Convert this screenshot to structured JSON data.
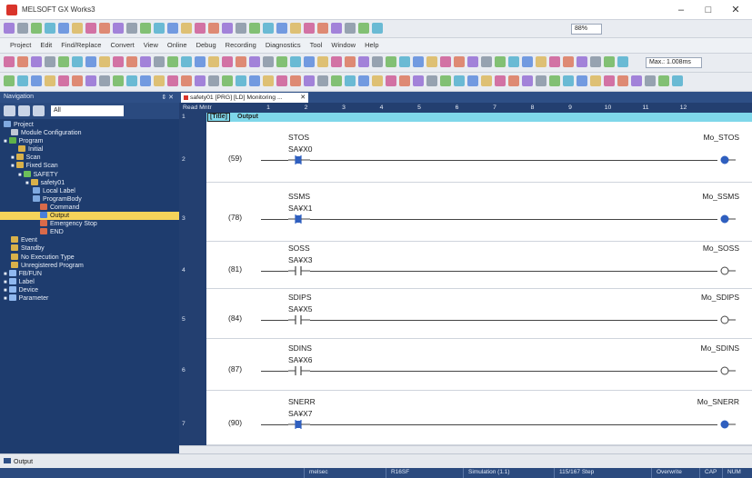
{
  "window": {
    "title": "MELSOFT GX Works3",
    "buttons": {
      "minimize": "–",
      "maximize": "□",
      "close": "✕"
    }
  },
  "menu": {
    "items": [
      "Project",
      "Edit",
      "Find/Replace",
      "Convert",
      "View",
      "Online",
      "Debug",
      "Recording",
      "Diagnostics",
      "Tool",
      "Window",
      "Help"
    ]
  },
  "toolbar": {
    "zoom": "88%",
    "max_scan": "Max.: 1.008ms"
  },
  "navigation": {
    "title": "Navigation",
    "pin": "⇕ ✕",
    "filter_value": "All",
    "tree": [
      {
        "label": "Project",
        "indent": 0,
        "icon": "#7fa9e0",
        "prefix": ""
      },
      {
        "label": "Module Configuration",
        "indent": 1,
        "icon": "#c0c8d6",
        "prefix": ""
      },
      {
        "label": "Program",
        "indent": 0,
        "icon": "#5fb24a",
        "prefix": "■"
      },
      {
        "label": "Initial",
        "indent": 2,
        "icon": "#d9b14a",
        "prefix": ""
      },
      {
        "label": "Scan",
        "indent": 1,
        "icon": "#d9b14a",
        "prefix": "■"
      },
      {
        "label": "Fixed Scan",
        "indent": 1,
        "icon": "#d9b14a",
        "prefix": "■"
      },
      {
        "label": "SAFETY",
        "indent": 2,
        "icon": "#6cc05a",
        "prefix": "■"
      },
      {
        "label": "safety01",
        "indent": 3,
        "icon": "#d9b14a",
        "prefix": "■"
      },
      {
        "label": "Local Label",
        "indent": 4,
        "icon": "#7fa9e0",
        "prefix": ""
      },
      {
        "label": "ProgramBody",
        "indent": 4,
        "icon": "#7fa9e0",
        "prefix": ""
      },
      {
        "label": "Command",
        "indent": 5,
        "icon": "#d96a4a",
        "prefix": ""
      },
      {
        "label": "Output",
        "indent": 5,
        "icon": "#4a7fd9",
        "prefix": "",
        "selected": true
      },
      {
        "label": "Emergency Stop",
        "indent": 5,
        "icon": "#d96a4a",
        "prefix": ""
      },
      {
        "label": "END",
        "indent": 5,
        "icon": "#d96a4a",
        "prefix": ""
      },
      {
        "label": "Event",
        "indent": 1,
        "icon": "#d9b14a",
        "prefix": ""
      },
      {
        "label": "Standby",
        "indent": 1,
        "icon": "#d9b14a",
        "prefix": ""
      },
      {
        "label": "No Execution Type",
        "indent": 1,
        "icon": "#d9b14a",
        "prefix": ""
      },
      {
        "label": "Unregistered Program",
        "indent": 1,
        "icon": "#d9b14a",
        "prefix": ""
      },
      {
        "label": "FB/FUN",
        "indent": 0,
        "icon": "#8fb8ef",
        "prefix": "■"
      },
      {
        "label": "Label",
        "indent": 0,
        "icon": "#8fb8ef",
        "prefix": "■"
      },
      {
        "label": "Device",
        "indent": 0,
        "icon": "#8fb8ef",
        "prefix": "■"
      },
      {
        "label": "Parameter",
        "indent": 0,
        "icon": "#8fb8ef",
        "prefix": "■"
      }
    ]
  },
  "editor": {
    "tab_label": "safety01 [PRG] [LD] Monitoring ...",
    "tab_close": "✕",
    "read_mode_label": "Read Mntr",
    "columns": [
      "1",
      "2",
      "3",
      "4",
      "5",
      "6",
      "7",
      "8",
      "9",
      "10",
      "11",
      "12"
    ],
    "title_row": {
      "row": "1",
      "tag": "[Title]",
      "text": "Output"
    },
    "rungs": [
      {
        "row": "2",
        "step": "(59)",
        "contact_name": "STOS",
        "contact_device": "SA¥X0",
        "coil": "Mo_STOS",
        "on": true
      },
      {
        "row": "3",
        "step": "(78)",
        "contact_name": "SSMS",
        "contact_device": "SA¥X1",
        "coil": "Mo_SSMS",
        "on": true
      },
      {
        "row": "4",
        "step": "(81)",
        "contact_name": "SOSS",
        "contact_device": "SA¥X3",
        "coil": "Mo_SOSS",
        "on": false
      },
      {
        "row": "5",
        "step": "(84)",
        "contact_name": "SDIPS",
        "contact_device": "SA¥X5",
        "coil": "Mo_SDIPS",
        "on": false
      },
      {
        "row": "6",
        "step": "(87)",
        "contact_name": "SDINS",
        "contact_device": "SA¥X6",
        "coil": "Mo_SDINS",
        "on": false
      },
      {
        "row": "7",
        "step": "(90)",
        "contact_name": "SNERR",
        "contact_device": "SA¥X7",
        "coil": "Mo_SNERR",
        "on": true
      }
    ]
  },
  "status": {
    "output_tab": "Output",
    "items": [
      "melsec",
      "R16SF",
      "Simulation (1.1)",
      "115/167 Step",
      "Overwrite",
      "CAP",
      "NUM"
    ]
  },
  "colors": {
    "nav_bg": "#1e3c6e",
    "header_bg": "#233f70",
    "title_row": "#7fd7ea",
    "energized": "#2f5fbf",
    "selected": "#f5d35a"
  }
}
